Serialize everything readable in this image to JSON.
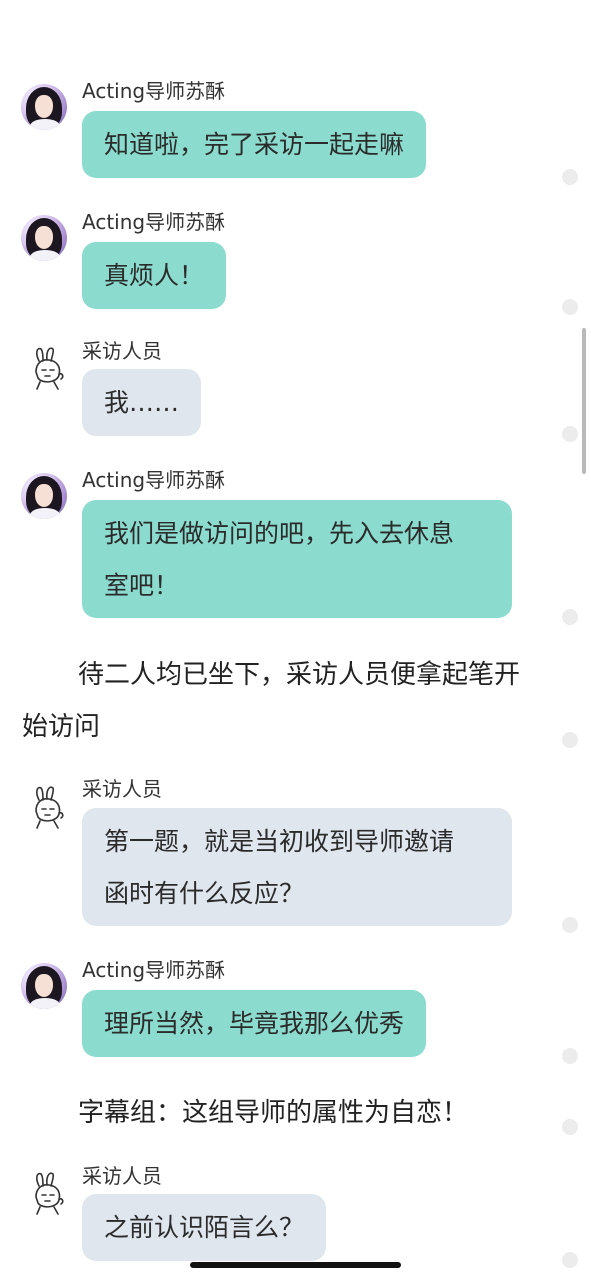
{
  "roles": {
    "mentor": "Acting导师苏酥",
    "interviewer": "采访人员"
  },
  "messages": [
    {
      "speaker": "Acting导师苏酥",
      "text": "知道啦，完了采访一起走嘛"
    },
    {
      "speaker": "Acting导师苏酥",
      "text": "真烦人！"
    },
    {
      "speaker": "采访人员",
      "text": "我……"
    },
    {
      "speaker": "Acting导师苏酥",
      "line1": "我们是做访问的吧，先入去休息",
      "line2": "室吧！"
    },
    {
      "speaker": "采访人员",
      "line1": "第一题，就是当初收到导师邀请",
      "line2": "函时有什么反应？"
    },
    {
      "speaker": "Acting导师苏酥",
      "text": "理所当然，毕竟我那么优秀"
    },
    {
      "speaker": "采访人员",
      "text": "之前认识陌言么？"
    }
  ],
  "narration": {
    "n1_line1": "待二人均已坐下，采访人员便拿起笔开",
    "n1_line2": "始访问",
    "n2": "字幕组：这组导师的属性为自恋！"
  },
  "colors": {
    "mentor_bubble": "#8bdbcf",
    "interviewer_bubble": "#dfe6ee",
    "background": "#ffffff"
  },
  "icons": {
    "mentor_avatar": "girl-portrait-avatar",
    "interviewer_avatar": "bunny-sketch-avatar"
  }
}
